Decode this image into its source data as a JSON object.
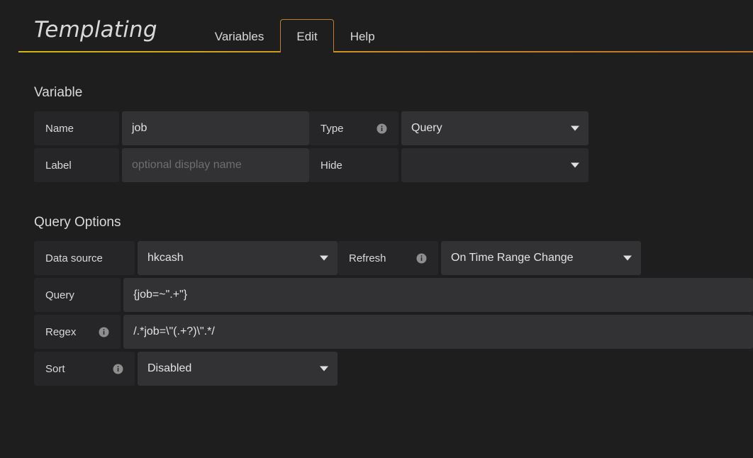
{
  "header": {
    "title": "Templating",
    "tabs": [
      {
        "label": "Variables",
        "active": false
      },
      {
        "label": "Edit",
        "active": true
      },
      {
        "label": "Help",
        "active": false
      }
    ]
  },
  "variable_section": {
    "title": "Variable",
    "name": {
      "label": "Name",
      "value": "job"
    },
    "label_field": {
      "label": "Label",
      "value": "",
      "placeholder": "optional display name"
    },
    "type": {
      "label": "Type",
      "info_icon": "info-icon",
      "value": "Query",
      "caret_icon": "chevron-down-icon"
    },
    "hide": {
      "label": "Hide",
      "value": "",
      "caret_icon": "chevron-down-icon"
    }
  },
  "query_options_section": {
    "title": "Query Options",
    "data_source": {
      "label": "Data source",
      "value": "hkcash",
      "caret_icon": "chevron-down-icon"
    },
    "refresh": {
      "label": "Refresh",
      "info_icon": "info-icon",
      "value": "On Time Range Change",
      "caret_icon": "chevron-down-icon"
    },
    "query": {
      "label": "Query",
      "value": "{job=~\".+\"}"
    },
    "regex": {
      "label": "Regex",
      "info_icon": "info-icon",
      "value": "/.*job=\\\"(.+?)\\\".*/"
    },
    "sort": {
      "label": "Sort",
      "info_icon": "info-icon",
      "value": "Disabled",
      "caret_icon": "chevron-down-icon"
    }
  },
  "colors": {
    "page_background": "#1e1e1e",
    "label_cell": "#262628",
    "field": "#323234",
    "accent_tab": "#c27c2c",
    "accent_underline_left": "#d5b418",
    "accent_underline_right": "#bf7427",
    "text": "#d8d9da",
    "placeholder_text": "#6e6e6e"
  }
}
